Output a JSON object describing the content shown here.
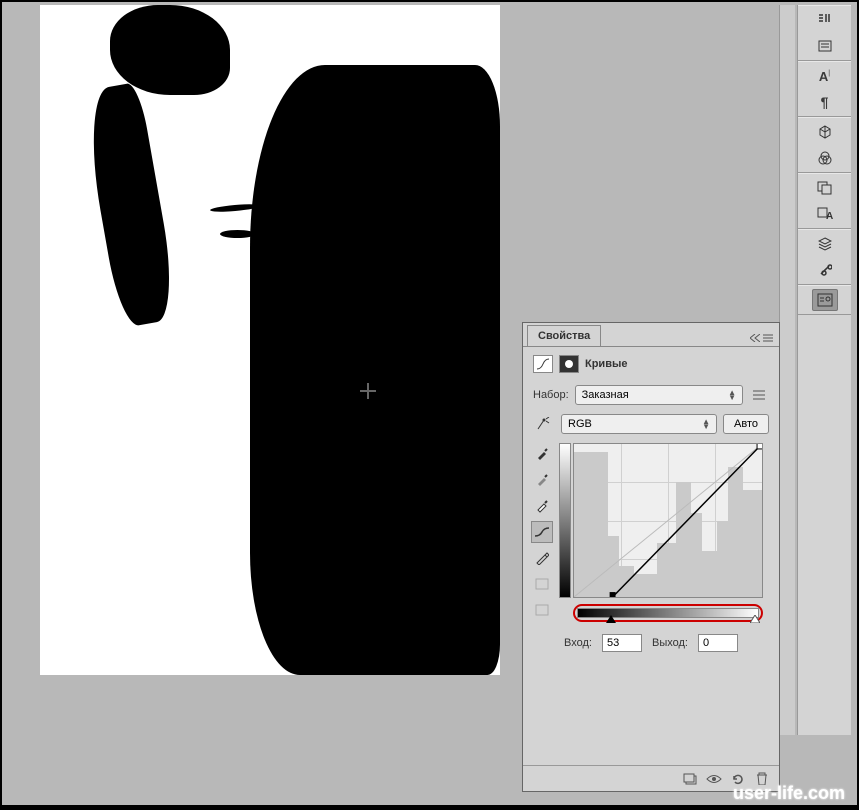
{
  "panel": {
    "tab_title": "Свойства",
    "header_title": "Кривые",
    "preset_label": "Набор:",
    "preset_value": "Заказная",
    "channel_value": "RGB",
    "auto_label": "Авто",
    "input_label": "Вход:",
    "input_value": "53",
    "output_label": "Выход:",
    "output_value": "0"
  },
  "toolbar": {
    "items": [
      "brush",
      "history",
      "character",
      "paragraph",
      "3d",
      "materials",
      "clone",
      "type-kit",
      "layers",
      "tools",
      "settings"
    ]
  },
  "watermark": "user-life.com",
  "chart_data": {
    "type": "line",
    "title": "Кривые",
    "xlabel": "Вход",
    "ylabel": "Выход",
    "xlim": [
      0,
      255
    ],
    "ylim": [
      0,
      255
    ],
    "series": [
      {
        "name": "RGB curve",
        "points": [
          {
            "x": 53,
            "y": 0
          },
          {
            "x": 255,
            "y": 255
          }
        ]
      }
    ],
    "black_point": 53,
    "white_point": 255,
    "histogram_hint": "bimodal high-contrast: large mass near blacks (0-30), large mass near whites (220-255), sparse midtones"
  }
}
